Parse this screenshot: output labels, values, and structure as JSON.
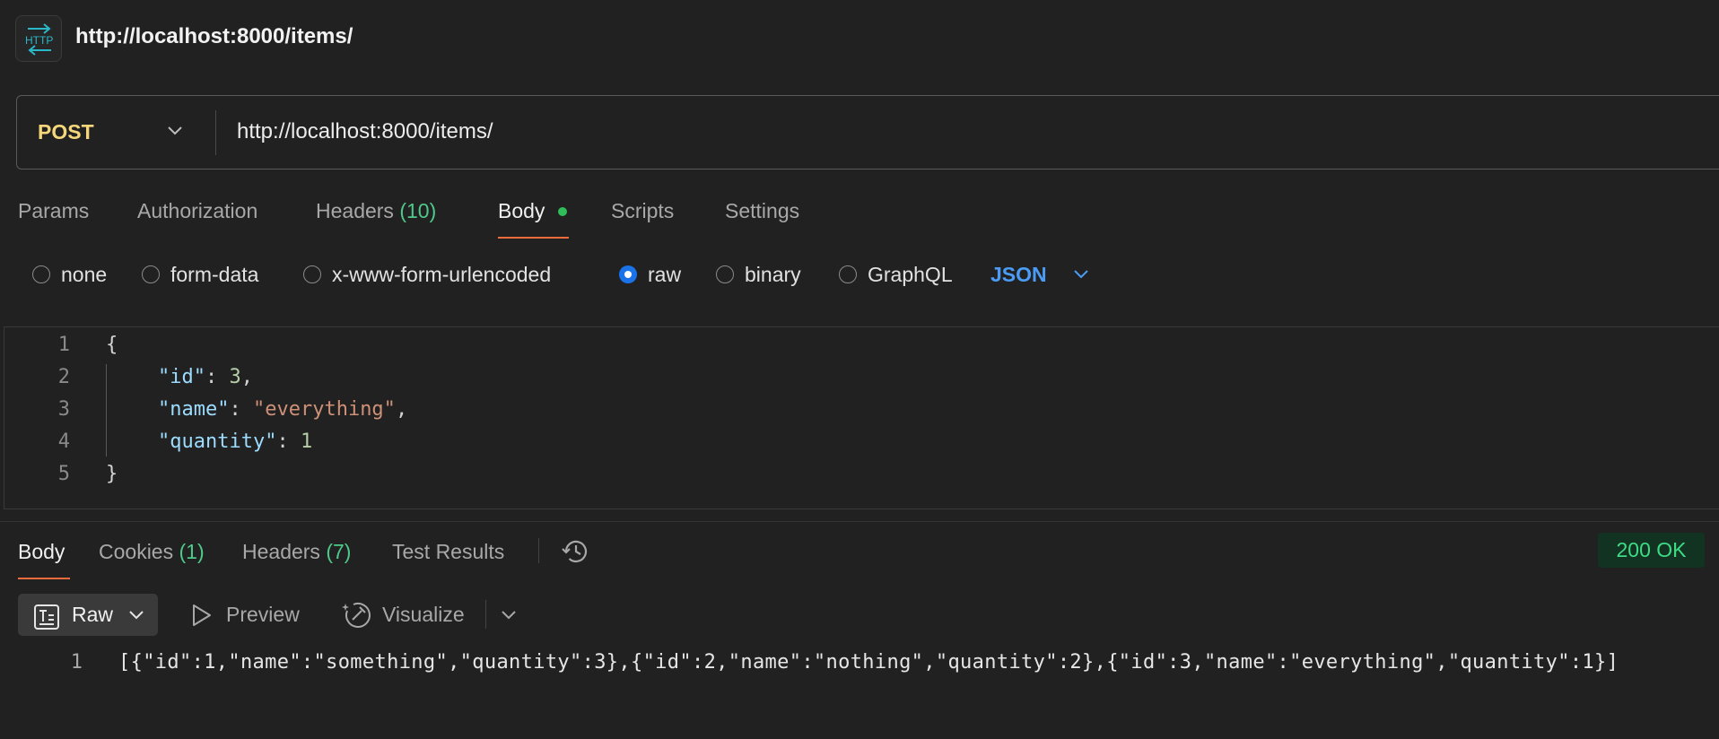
{
  "header": {
    "icon": "http-icon",
    "title": "http://localhost:8000/items/"
  },
  "request": {
    "method": "POST",
    "url": "http://localhost:8000/items/"
  },
  "request_tabs": {
    "params": "Params",
    "authorization": "Authorization",
    "headers": "Headers",
    "headers_count": "(10)",
    "body": "Body",
    "scripts": "Scripts",
    "settings": "Settings",
    "active": "Body"
  },
  "body_types": {
    "none": "none",
    "form_data": "form-data",
    "urlencoded": "x-www-form-urlencoded",
    "raw": "raw",
    "binary": "binary",
    "graphql": "GraphQL",
    "selected": "raw",
    "format": "JSON"
  },
  "editor": {
    "line_numbers": [
      "1",
      "2",
      "3",
      "4",
      "5"
    ],
    "lines": {
      "l1": "{",
      "l2_key": "\"id\"",
      "l2_colon": ": ",
      "l2_value": "3",
      "l2_comma": ",",
      "l3_key": "\"name\"",
      "l3_colon": ": ",
      "l3_value": "\"everything\"",
      "l3_comma": ",",
      "l4_key": "\"quantity\"",
      "l4_colon": ": ",
      "l4_value": "1",
      "l5": "}"
    }
  },
  "response_tabs": {
    "body": "Body",
    "cookies": "Cookies",
    "cookies_count": "(1)",
    "headers": "Headers",
    "headers_count": "(7)",
    "test_results": "Test Results",
    "active": "Body"
  },
  "status": "200 OK",
  "response_toolbar": {
    "raw": "Raw",
    "preview": "Preview",
    "visualize": "Visualize"
  },
  "response_body": {
    "line_number": "1",
    "text": "[{\"id\":1,\"name\":\"something\",\"quantity\":3},{\"id\":2,\"name\":\"nothing\",\"quantity\":2},{\"id\":3,\"name\":\"everything\",\"quantity\":1}]"
  },
  "colors": {
    "background": "#212121",
    "method": "#f5d77b",
    "accent_tab": "#f26b3a",
    "count_green": "#4fc98a",
    "json_blue": "#4b9cf5",
    "status_green": "#3ddc84",
    "radio_selected": "#1a73e8"
  }
}
